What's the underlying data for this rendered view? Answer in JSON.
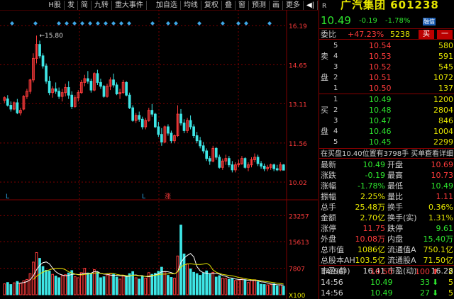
{
  "toolbar": {
    "items": [
      "H股",
      "发",
      "简",
      "九转",
      "重大事件",
      "",
      "加自选",
      "均线",
      "复权",
      "叠",
      "窗",
      "预测",
      "画",
      "更多",
      "◀|"
    ]
  },
  "stock": {
    "marker": "R",
    "name": "广汽集团",
    "code": "601238",
    "price": "10.49",
    "change": "-0.19",
    "change_pct": "-1.78%",
    "badge": "融信"
  },
  "ratio": {
    "label": "委比",
    "pct": "+47.23%",
    "value": "5238",
    "buy_label": "买",
    "sell_label": "一"
  },
  "asks": [
    {
      "side": "",
      "level": "5",
      "price": "10.54",
      "volume": "580"
    },
    {
      "side": "卖",
      "level": "4",
      "price": "10.53",
      "volume": "591"
    },
    {
      "side": "",
      "level": "3",
      "price": "10.52",
      "volume": "545"
    },
    {
      "side": "盘",
      "level": "2",
      "price": "10.51",
      "volume": "1072"
    },
    {
      "side": "",
      "level": "1",
      "price": "10.50",
      "volume": "137"
    }
  ],
  "bids": [
    {
      "side": "",
      "level": "1",
      "price": "10.49",
      "volume": "1200"
    },
    {
      "side": "买",
      "level": "2",
      "price": "10.48",
      "volume": "2804"
    },
    {
      "side": "",
      "level": "3",
      "price": "10.47",
      "volume": "846"
    },
    {
      "side": "盘",
      "level": "4",
      "price": "10.46",
      "volume": "1004"
    },
    {
      "side": "",
      "level": "5",
      "price": "10.45",
      "volume": "2299"
    }
  ],
  "midline": {
    "text": "在买盘10.40位置有3798手 买单!",
    "link": "查看详细"
  },
  "stats": [
    {
      "k": "最新",
      "v": "10.49",
      "vc": "g",
      "k2": "开盘",
      "v2": "10.69",
      "v2c": "r"
    },
    {
      "k": "涨跌",
      "v": "-0.19",
      "vc": "g",
      "k2": "最高",
      "v2": "10.73",
      "v2c": "r"
    },
    {
      "k": "涨幅",
      "v": "-1.78%",
      "vc": "g",
      "k2": "最低",
      "v2": "10.49",
      "v2c": "g"
    },
    {
      "k": "振幅",
      "v": "2.25%",
      "vc": "y",
      "k2": "量比",
      "v2": "1.11",
      "v2c": "r"
    },
    {
      "k": "总手",
      "v": "25.48万",
      "vc": "y",
      "k2": "换手",
      "v2": "0.36%",
      "v2c": "y"
    },
    {
      "k": "金额",
      "v": "2.70亿",
      "vc": "y",
      "k2": "换手(实)",
      "v2": "1.31%",
      "v2c": "y"
    },
    {
      "k": "涨停",
      "v": "11.75",
      "vc": "r",
      "k2": "跌停",
      "v2": "9.61",
      "v2c": "g"
    },
    {
      "k": "外盘",
      "v": "10.08万",
      "vc": "r",
      "k2": "内盘",
      "v2": "15.40万",
      "v2c": "g"
    },
    {
      "k": "总市值",
      "v": "1086亿",
      "vc": "y",
      "k2": "流通值A",
      "v2": "750.1亿",
      "v2c": "y"
    },
    {
      "k": "总股本AH",
      "v": "103.5亿",
      "vc": "y",
      "k2": "流通股A",
      "v2": "71.50亿",
      "v2c": "y"
    },
    {
      "k": "市盈(静)",
      "v": "16.41",
      "vc": "w",
      "k2": "市盈(动)",
      "v2": "16.28",
      "v2c": "w"
    }
  ],
  "ticks": [
    {
      "time": "14:56",
      "price": "10.50",
      "pc": "r",
      "vol": "100",
      "vc": "r",
      "dir": "up",
      "n": "2"
    },
    {
      "time": "14:56",
      "price": "10.49",
      "pc": "g",
      "vol": "33",
      "vc": "g",
      "dir": "down",
      "n": "5"
    },
    {
      "time": "14:56",
      "price": "10.49",
      "pc": "g",
      "vol": "27",
      "vc": "g",
      "dir": "down",
      "n": "5"
    }
  ],
  "chart_data": {
    "type": "candlestick",
    "price_axis": [
      "16.19",
      "14.65",
      "13.11",
      "11.56",
      "10.02"
    ],
    "price_ylim": [
      9.6,
      16.7
    ],
    "volume_axis": [
      "23257",
      "15613",
      "7807",
      "X100"
    ],
    "volume_ylim": [
      0,
      25000
    ],
    "high_label": "←15.80",
    "markers": [
      "L",
      "L",
      "涨"
    ],
    "colors": {
      "up": "#ff3b3b",
      "down": "#3ee6e6",
      "ma1": "#ffffff",
      "ma2": "#e6e600",
      "grid": "#800000"
    },
    "candles": [
      [
        13.25,
        13.4,
        13.15,
        13.35,
        3.2
      ],
      [
        13.3,
        13.45,
        13.0,
        13.05,
        3.6
      ],
      [
        13.05,
        13.2,
        12.8,
        12.9,
        3.0
      ],
      [
        12.9,
        13.2,
        12.85,
        13.15,
        3.5
      ],
      [
        13.15,
        13.3,
        12.7,
        12.75,
        3.9
      ],
      [
        12.75,
        12.95,
        12.65,
        12.85,
        3.3
      ],
      [
        12.9,
        13.45,
        12.85,
        13.4,
        4.1
      ],
      [
        13.4,
        13.7,
        13.3,
        13.6,
        4.5
      ],
      [
        13.6,
        14.1,
        13.5,
        14.05,
        6.2
      ],
      [
        14.05,
        15.1,
        13.95,
        14.9,
        9.6
      ],
      [
        14.9,
        15.8,
        14.7,
        15.45,
        12.4
      ],
      [
        15.45,
        15.6,
        14.9,
        15.0,
        10.7
      ],
      [
        15.0,
        15.1,
        14.5,
        14.6,
        8.3
      ],
      [
        14.6,
        14.7,
        13.9,
        14.0,
        7.2
      ],
      [
        14.0,
        14.2,
        13.45,
        13.55,
        7.0
      ],
      [
        13.55,
        13.8,
        13.35,
        13.7,
        6.0
      ],
      [
        13.7,
        13.95,
        13.5,
        13.6,
        5.5
      ],
      [
        13.6,
        13.75,
        13.3,
        13.4,
        5.0
      ],
      [
        13.4,
        13.7,
        13.2,
        13.55,
        5.6
      ],
      [
        13.55,
        13.9,
        13.4,
        13.75,
        5.9
      ],
      [
        13.75,
        14.0,
        13.3,
        13.45,
        6.4
      ],
      [
        13.45,
        13.6,
        12.9,
        13.0,
        7.1
      ],
      [
        13.0,
        13.45,
        12.95,
        13.35,
        5.3
      ],
      [
        13.35,
        13.65,
        13.2,
        13.55,
        5.0
      ],
      [
        13.55,
        14.05,
        13.5,
        13.95,
        6.5
      ],
      [
        13.95,
        14.25,
        13.8,
        14.1,
        7.8
      ],
      [
        14.1,
        14.4,
        13.9,
        14.0,
        6.4
      ],
      [
        14.0,
        14.1,
        13.55,
        13.65,
        6.0
      ],
      [
        13.65,
        14.35,
        13.6,
        14.3,
        7.4
      ],
      [
        14.3,
        14.45,
        13.85,
        13.95,
        6.6
      ],
      [
        13.95,
        14.1,
        13.7,
        13.8,
        5.0
      ],
      [
        13.8,
        13.85,
        13.35,
        13.4,
        5.3
      ],
      [
        13.4,
        13.9,
        13.35,
        13.8,
        5.8
      ],
      [
        13.8,
        14.15,
        13.65,
        14.05,
        6.3
      ],
      [
        14.05,
        14.3,
        13.75,
        13.85,
        6.0
      ],
      [
        13.85,
        13.95,
        13.45,
        13.5,
        5.2
      ],
      [
        13.5,
        13.7,
        13.3,
        13.55,
        4.6
      ],
      [
        13.55,
        14.05,
        13.5,
        13.95,
        5.7
      ],
      [
        13.95,
        14.0,
        13.4,
        13.45,
        5.5
      ],
      [
        13.45,
        13.55,
        12.9,
        12.95,
        6.2
      ],
      [
        12.95,
        13.05,
        12.4,
        12.45,
        6.8
      ],
      [
        12.45,
        12.75,
        12.35,
        12.65,
        5.0
      ],
      [
        12.65,
        12.8,
        12.4,
        12.5,
        4.6
      ],
      [
        12.5,
        12.6,
        12.1,
        12.2,
        5.5
      ],
      [
        12.2,
        12.55,
        12.1,
        12.45,
        4.9
      ],
      [
        12.45,
        12.95,
        12.4,
        12.85,
        6.5
      ],
      [
        12.85,
        13.1,
        12.6,
        12.7,
        6.0
      ],
      [
        12.7,
        12.75,
        12.15,
        12.2,
        6.3
      ],
      [
        12.2,
        12.4,
        11.8,
        11.9,
        6.9
      ],
      [
        11.9,
        12.15,
        11.45,
        11.6,
        8.1
      ],
      [
        11.6,
        12.25,
        11.55,
        12.2,
        6.8
      ],
      [
        12.2,
        12.3,
        11.85,
        11.95,
        5.7
      ],
      [
        11.95,
        12.05,
        11.55,
        11.65,
        5.1
      ],
      [
        11.65,
        11.9,
        11.55,
        11.85,
        4.9
      ],
      [
        11.85,
        13.05,
        11.8,
        12.7,
        11.4
      ],
      [
        12.7,
        12.9,
        12.25,
        12.35,
        20.5
      ],
      [
        12.35,
        12.5,
        11.95,
        12.05,
        12.0
      ],
      [
        12.05,
        12.55,
        11.95,
        12.45,
        9.1
      ],
      [
        12.45,
        12.65,
        12.1,
        12.2,
        7.6
      ],
      [
        12.2,
        12.3,
        11.75,
        11.85,
        6.6
      ],
      [
        11.85,
        12.0,
        11.55,
        11.65,
        6.2
      ],
      [
        11.65,
        11.8,
        11.35,
        11.45,
        5.7
      ],
      [
        11.45,
        11.6,
        11.15,
        11.25,
        6.3
      ],
      [
        11.25,
        11.35,
        10.85,
        10.95,
        7.0
      ],
      [
        10.95,
        11.05,
        10.7,
        10.85,
        6.0
      ],
      [
        10.85,
        11.45,
        10.8,
        11.35,
        6.6
      ],
      [
        11.35,
        11.4,
        10.9,
        11.0,
        5.2
      ],
      [
        11.0,
        11.1,
        10.55,
        10.6,
        5.6
      ],
      [
        10.6,
        10.95,
        10.5,
        10.85,
        4.9
      ],
      [
        10.85,
        11.1,
        10.7,
        10.95,
        4.8
      ],
      [
        10.95,
        11.05,
        10.6,
        10.7,
        4.5
      ],
      [
        10.7,
        10.85,
        10.4,
        10.5,
        4.7
      ],
      [
        10.5,
        10.8,
        10.4,
        10.7,
        4.2
      ],
      [
        10.7,
        10.9,
        10.6,
        10.75,
        4.3
      ],
      [
        10.75,
        11.05,
        10.7,
        10.95,
        4.6
      ],
      [
        10.95,
        11.0,
        10.55,
        10.6,
        4.4
      ],
      [
        10.6,
        10.8,
        10.45,
        10.7,
        3.6
      ],
      [
        10.7,
        11.0,
        10.6,
        10.9,
        4.2
      ],
      [
        10.9,
        11.15,
        10.8,
        11.0,
        4.4
      ],
      [
        11.0,
        11.1,
        10.65,
        10.75,
        3.8
      ],
      [
        10.75,
        10.85,
        10.55,
        10.65,
        3.1
      ],
      [
        10.65,
        10.75,
        10.45,
        10.55,
        3.0
      ],
      [
        10.55,
        10.7,
        10.45,
        10.6,
        2.9
      ],
      [
        10.6,
        10.75,
        10.5,
        10.7,
        3.0
      ],
      [
        10.7,
        10.75,
        10.45,
        10.55,
        3.2
      ],
      [
        10.55,
        10.7,
        10.45,
        10.5,
        2.6
      ],
      [
        10.5,
        10.8,
        10.45,
        10.7,
        2.9
      ],
      [
        10.7,
        10.73,
        10.49,
        10.49,
        2.5
      ]
    ]
  }
}
